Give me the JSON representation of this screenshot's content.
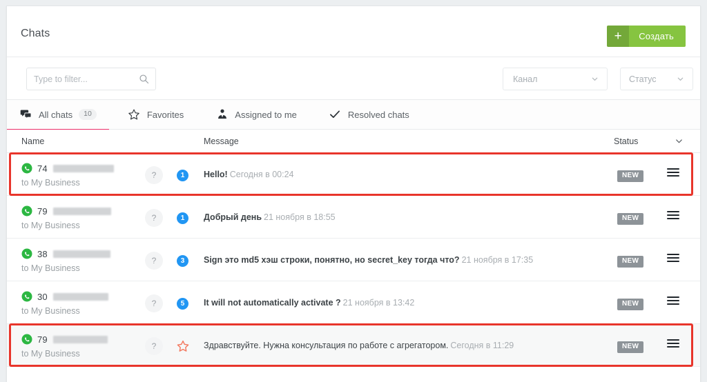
{
  "header": {
    "title": "Chats",
    "create_button": {
      "label": "Создать",
      "plus": "+",
      "color": "#86c440",
      "plus_color": "#73a839"
    }
  },
  "filters": {
    "search": {
      "value": "",
      "placeholder": "Type to filter...",
      "icon": "search-icon"
    },
    "channel": {
      "label": "Канал",
      "icon": "chevron-down-icon"
    },
    "status": {
      "label": "Статус",
      "icon": "chevron-down-icon"
    }
  },
  "tabs": [
    {
      "label": "All chats",
      "count": "10",
      "icon": "chats-icon",
      "active": true
    },
    {
      "label": "Favorites",
      "count": "",
      "icon": "star-icon",
      "active": false
    },
    {
      "label": "Assigned to me",
      "count": "",
      "icon": "assigned-person-icon",
      "active": false
    },
    {
      "label": "Resolved chats",
      "count": "",
      "icon": "check-icon",
      "active": false
    }
  ],
  "table": {
    "columns": {
      "name": "Name",
      "message": "Message",
      "status": "Status"
    },
    "sort_icon": "chevron-down-icon",
    "rows": [
      {
        "channel_icon": "whatsapp-icon",
        "number_prefix": "74",
        "redacted": true,
        "subtitle": "to My Business",
        "avatar": "?",
        "marker": {
          "type": "badge",
          "value": "1",
          "color": "#2196f3"
        },
        "message_text": "Hello!",
        "message_bold": true,
        "message_time": "Сегодня в 00:24",
        "status": "NEW",
        "highlighted": true,
        "hovered": false
      },
      {
        "channel_icon": "whatsapp-icon",
        "number_prefix": "79",
        "redacted": true,
        "subtitle": "to My Business",
        "avatar": "?",
        "marker": {
          "type": "badge",
          "value": "1",
          "color": "#2196f3"
        },
        "message_text": "Добрый день",
        "message_bold": true,
        "message_time": "21 ноября в 18:55",
        "status": "NEW",
        "highlighted": false,
        "hovered": false
      },
      {
        "channel_icon": "whatsapp-icon",
        "number_prefix": "38",
        "redacted": true,
        "subtitle": "to My Business",
        "avatar": "?",
        "marker": {
          "type": "badge",
          "value": "3",
          "color": "#2196f3"
        },
        "message_text": "Sign это md5 хэш строки, понятно, но secret_key тогда что?",
        "message_bold": true,
        "message_time": "21 ноября в 17:35",
        "status": "NEW",
        "highlighted": false,
        "hovered": false
      },
      {
        "channel_icon": "whatsapp-icon",
        "number_prefix": "30",
        "redacted": true,
        "subtitle": "to My Business",
        "avatar": "?",
        "marker": {
          "type": "badge",
          "value": "5",
          "color": "#2196f3"
        },
        "message_text": "It will not automatically activate ?",
        "message_bold": true,
        "message_time": "21 ноября в 13:42",
        "status": "NEW",
        "highlighted": false,
        "hovered": false
      },
      {
        "channel_icon": "whatsapp-icon",
        "number_prefix": "79",
        "redacted": true,
        "subtitle": "to My Business",
        "avatar": "?",
        "marker": {
          "type": "star",
          "value": "",
          "color": "#f3795f"
        },
        "message_text": "Здравствуйте. Нужна консультация по работе с агрегатором.",
        "message_bold": false,
        "message_time": "Сегодня в 11:29",
        "status": "NEW",
        "highlighted": true,
        "hovered": true
      }
    ]
  }
}
